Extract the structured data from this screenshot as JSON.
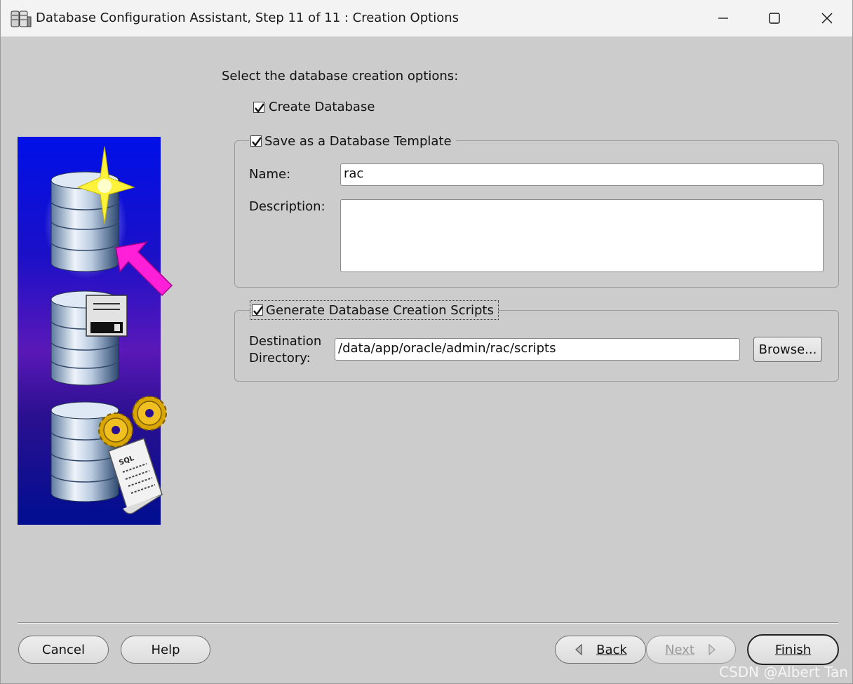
{
  "window": {
    "title": "Database Configuration Assistant, Step 11 of 11 : Creation Options"
  },
  "colors": {
    "window_bg": "#cccccc",
    "titlebar_bg": "#f3f3f3",
    "art_blue": "#0010e8",
    "art_purple": "#5a18b8",
    "arrow_magenta": "#ff1fd8"
  },
  "options": {
    "prompt": "Select the database creation options:",
    "create_database": {
      "label": "Create Database",
      "checked": true
    },
    "save_template": {
      "label": "Save as a Database Template",
      "checked": true,
      "name_label": "Name:",
      "name_value": "rac",
      "description_label": "Description:",
      "description_value": ""
    },
    "generate_scripts": {
      "label": "Generate Database Creation Scripts",
      "checked": true,
      "dest_label_line1": "Destination",
      "dest_label_line2": "Directory:",
      "dest_value": "/data/app/oracle/admin/rac/scripts",
      "browse_label": "Browse..."
    }
  },
  "buttons": {
    "cancel": "Cancel",
    "help": "Help",
    "back": "Back",
    "next": "Next",
    "finish": "Finish"
  },
  "art": {
    "sql_text": "SQL"
  },
  "watermark": "CSDN @Albert Tan"
}
